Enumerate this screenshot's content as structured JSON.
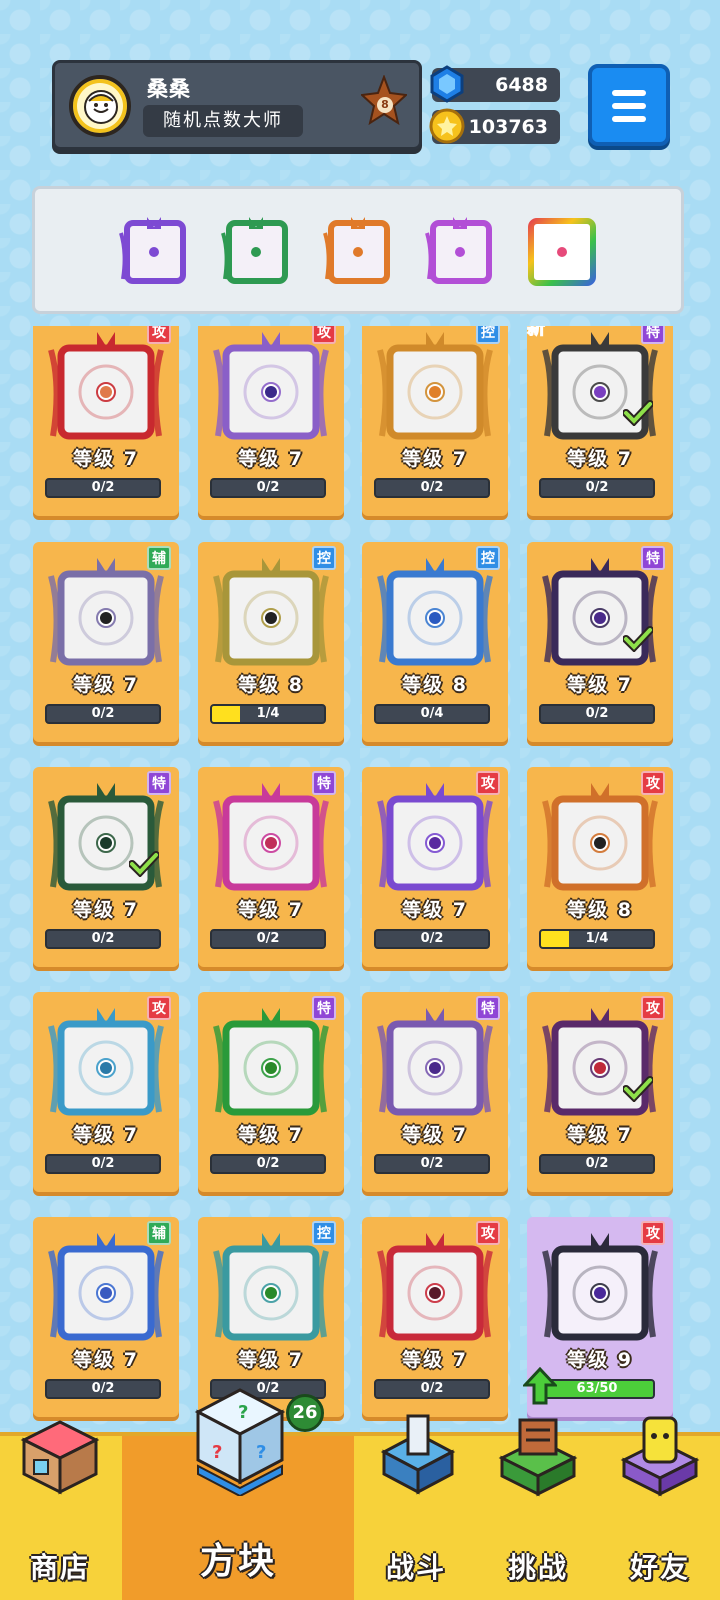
{
  "profile": {
    "name": "桑桑",
    "title": "随机点数大师",
    "rank": "8"
  },
  "currency": {
    "gems": "6488",
    "coins": "103763"
  },
  "deck": [
    {
      "name": "purple-dice",
      "color": "#7d4ad3"
    },
    {
      "name": "green-dice",
      "color": "#2e9a52"
    },
    {
      "name": "infinity-dice",
      "color": "#e07a2a"
    },
    {
      "name": "combo-dice",
      "color": "#b24fd6"
    },
    {
      "name": "rainbow-dice",
      "color": "#e64a7a"
    }
  ],
  "level_prefix": "等级",
  "cards": [
    {
      "level": "等级 7",
      "progress": "0/2",
      "fill": 0,
      "tag": "攻",
      "tag_type": "atk",
      "color": "#c8292f",
      "dot": "#e07a4a",
      "art": "compass-icon"
    },
    {
      "level": "等级 7",
      "progress": "0/2",
      "fill": 0,
      "tag": "攻",
      "tag_type": "atk",
      "color": "#8a5fc8",
      "dot": "#3b2a8a",
      "art": "gear-icon"
    },
    {
      "level": "等级 7",
      "progress": "0/2",
      "fill": 0,
      "tag": "控",
      "tag_type": "ctl",
      "color": "#d08a2a",
      "dot": "#e0802a",
      "art": "sand-icon"
    },
    {
      "level": "等级 7",
      "progress": "0/2",
      "fill": 0,
      "tag": "特",
      "tag_type": "spe",
      "color": "#3a3a3a",
      "dot": "#7a40c0",
      "art": "infinity-icon",
      "new": "新",
      "owned": true
    },
    {
      "level": "等级 7",
      "progress": "0/2",
      "fill": 0,
      "tag": "辅",
      "tag_type": "sup",
      "color": "#7a6fa8",
      "dot": "#222222",
      "art": "crown-icon"
    },
    {
      "level": "等级 8",
      "progress": "1/4",
      "fill": 0.25,
      "tag": "控",
      "tag_type": "ctl",
      "color": "#a8963a",
      "dot": "#222222",
      "art": "shield-icon"
    },
    {
      "level": "等级 8",
      "progress": "0/4",
      "fill": 0,
      "tag": "控",
      "tag_type": "ctl",
      "color": "#3a7ad0",
      "dot": "#2a5ac0",
      "art": "snowflake-icon"
    },
    {
      "level": "等级 7",
      "progress": "0/2",
      "fill": 0,
      "tag": "特",
      "tag_type": "spe",
      "color": "#3a2a5a",
      "dot": "#4a2a8a",
      "art": "diamond-icon",
      "owned": true
    },
    {
      "level": "等级 7",
      "progress": "0/2",
      "fill": 0,
      "tag": "特",
      "tag_type": "spe",
      "color": "#2a5a3a",
      "dot": "#1a3a2a",
      "art": "pentagram-icon",
      "owned": true
    },
    {
      "level": "等级 7",
      "progress": "0/2",
      "fill": 0,
      "tag": "特",
      "tag_type": "spe",
      "color": "#c83a9a",
      "dot": "#c0305a",
      "art": "cross-swords-icon"
    },
    {
      "level": "等级 7",
      "progress": "0/2",
      "fill": 0,
      "tag": "攻",
      "tag_type": "atk",
      "color": "#7a4ad0",
      "dot": "#5a2aa0",
      "art": "orbit-icon"
    },
    {
      "level": "等级 8",
      "progress": "1/4",
      "fill": 0.25,
      "tag": "攻",
      "tag_type": "atk",
      "color": "#d0702a",
      "dot": "#222222",
      "art": "pistol-icon"
    },
    {
      "level": "等级 7",
      "progress": "0/2",
      "fill": 0,
      "tag": "攻",
      "tag_type": "atk",
      "color": "#3a9ac8",
      "dot": "#2a7aa8",
      "art": "vortex-icon"
    },
    {
      "level": "等级 7",
      "progress": "0/2",
      "fill": 0,
      "tag": "特",
      "tag_type": "spe",
      "color": "#2a9a3a",
      "dot": "#2a8a2a",
      "art": "vine-icon"
    },
    {
      "level": "等级 7",
      "progress": "0/2",
      "fill": 0,
      "tag": "特",
      "tag_type": "spe",
      "color": "#7a5ab0",
      "dot": "#4a2a8a",
      "art": "eye-icon"
    },
    {
      "level": "等级 7",
      "progress": "0/2",
      "fill": 0,
      "tag": "攻",
      "tag_type": "atk",
      "color": "#5a2a6a",
      "dot": "#c02a3a",
      "art": "combo-icon",
      "owned": true
    },
    {
      "level": "等级 7",
      "progress": "0/2",
      "fill": 0,
      "tag": "辅",
      "tag_type": "sup",
      "color": "#3a6ad0",
      "dot": "#3a5ac0",
      "art": "moon-icon"
    },
    {
      "level": "等级 7",
      "progress": "0/2",
      "fill": 0,
      "tag": "控",
      "tag_type": "ctl",
      "color": "#3a9aa0",
      "dot": "#2a8a2a",
      "art": "wave-icon"
    },
    {
      "level": "等级 7",
      "progress": "0/2",
      "fill": 0,
      "tag": "攻",
      "tag_type": "atk",
      "color": "#c82a3a",
      "dot": "#5a1a2a",
      "art": "sawblade-icon"
    },
    {
      "level": "等级 9",
      "progress": "63/50",
      "fill": 1,
      "tag": "攻",
      "tag_type": "atk",
      "color": "#2a2a3a",
      "dot": "#4a2a9a",
      "art": "scythe-icon",
      "lilac": true,
      "upgrade": true
    }
  ],
  "box_count": "26",
  "nav": {
    "shop": "商店",
    "cubes": "方块",
    "battle": "战斗",
    "challenge": "挑战",
    "friends": "好友"
  }
}
